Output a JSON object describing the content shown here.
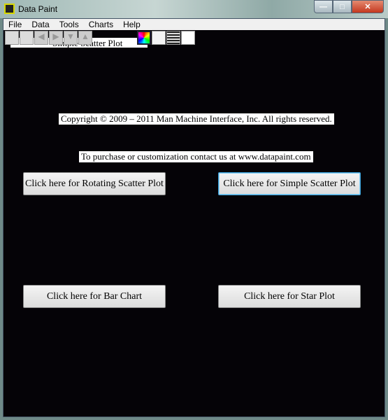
{
  "window": {
    "title": "Data Paint"
  },
  "menu": [
    "File",
    "Data",
    "Tools",
    "Charts",
    "Help"
  ],
  "toolbar": {
    "hidden_label": "Simple Scatter Plot",
    "icons": [
      "page-icon",
      "stop-icon",
      "back-icon",
      "forward-icon",
      "down-icon",
      "up-icon",
      "palette-icon",
      "blank-icon",
      "lines-icon",
      "white-icon"
    ]
  },
  "main": {
    "copyright": "Copyright © 2009 – 2011 Man Machine Interface, Inc.  All rights reserved.",
    "contact": "To purchase or customization contact us at www.datapaint.com",
    "buttons": {
      "rotating": "Click here for Rotating Scatter Plot",
      "simple": "Click here for Simple Scatter Plot",
      "bar": "Click here for Bar Chart",
      "star": "Click here for Star Plot"
    }
  }
}
